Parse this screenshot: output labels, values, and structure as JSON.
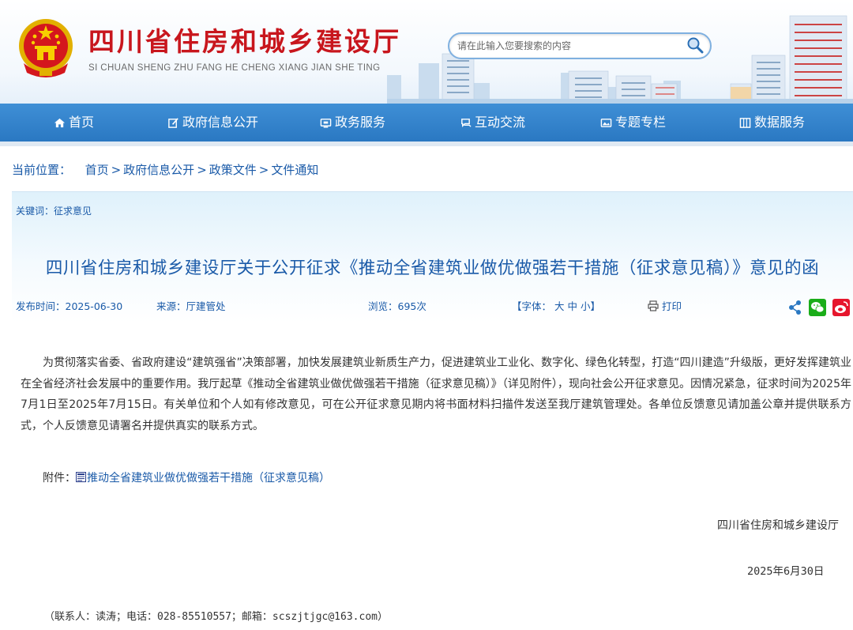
{
  "header": {
    "site_title": "四川省住房和城乡建设厅",
    "site_pinyin": "SI CHUAN SHENG ZHU FANG HE CHENG XIANG JIAN SHE TING",
    "search_placeholder": "请在此输入您要搜索的内容",
    "emblem_icon": "national-emblem-icon",
    "search_icon": "search-icon"
  },
  "nav": {
    "items": [
      {
        "label": "首页",
        "icon": "home-icon"
      },
      {
        "label": "政府信息公开",
        "icon": "edit-icon"
      },
      {
        "label": "政务服务",
        "icon": "monitor-icon"
      },
      {
        "label": "互动交流",
        "icon": "exchange-icon"
      },
      {
        "label": "专题专栏",
        "icon": "image-icon"
      },
      {
        "label": "数据服务",
        "icon": "grid-icon"
      }
    ]
  },
  "breadcrumb": {
    "label": "当前位置：",
    "items": [
      "首页",
      "政府信息公开",
      "政策文件",
      "文件通知"
    ],
    "separator": ">"
  },
  "article": {
    "keywords": "关键词：征求意见",
    "title": "四川省住房和城乡建设厅关于公开征求《推动全省建筑业做优做强若干措施（征求意见稿）》意见的函",
    "meta": {
      "publish": "发布时间：2025-06-30",
      "source": "来源：厅建管处",
      "views": "浏览：695次",
      "font_label": "【字体：",
      "font_large": "大",
      "font_medium": "中",
      "font_small": "小",
      "font_close": "】",
      "print": "打印"
    },
    "body": "为贯彻落实省委、省政府建设“建筑强省”决策部署，加快发展建筑业新质生产力，促进建筑业工业化、数字化、绿色化转型，打造“四川建造”升级版，更好发挥建筑业在全省经济社会发展中的重要作用。我厅起草《推动全省建筑业做优做强若干措施（征求意见稿）》（详见附件），现向社会公开征求意见。因情况紧急，征求时间为2025年7月1日至2025年7月15日。有关单位和个人如有修改意见，可在公开征求意见期内将书面材料扫描件发送至我厅建筑管理处。各单位反馈意见请加盖公章并提供联系方式，个人反馈意见请署名并提供真实的联系方式。",
    "attachment_label": "附件：",
    "attachment_link": "推动全省建筑业做优做强若干措施（征求意见稿）",
    "signature_org": "四川省住房和城乡建设厅",
    "signature_date": "2025年6月30日",
    "contact": "（联系人：读涛；电话：028-85510557；邮箱：scszjtjgc@163.com）"
  },
  "colors": {
    "title_red": "#c8161d",
    "nav_blue": "#2f80c9",
    "link_blue": "#1a5aa8",
    "wechat_green": "#1aad19",
    "weibo_red": "#e6162d"
  }
}
